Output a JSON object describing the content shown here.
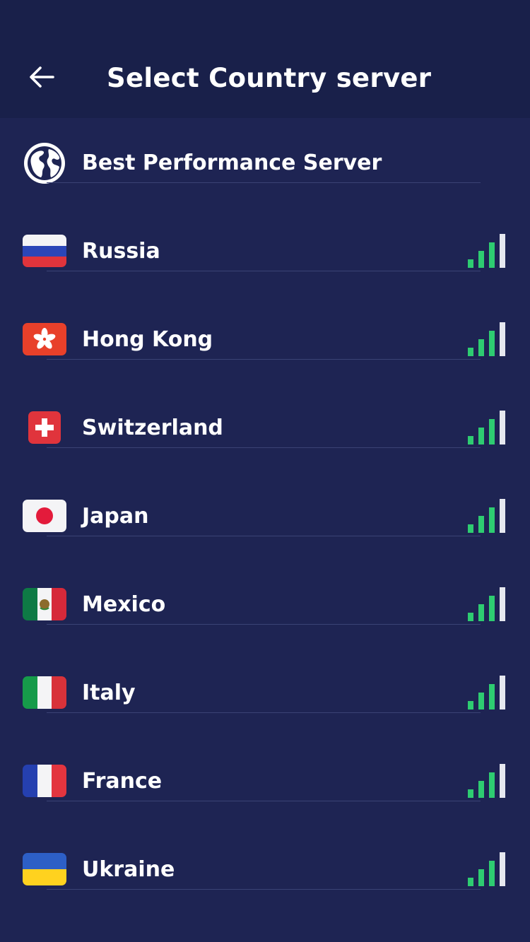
{
  "header": {
    "title": "Select Country server",
    "back_icon": "arrow-left-icon"
  },
  "best_server": {
    "label": "Best Performance Server",
    "icon": "globe-icon"
  },
  "countries": [
    {
      "name": "Russia",
      "flag": "flag-russia-icon"
    },
    {
      "name": "Hong Kong",
      "flag": "flag-hong-kong-icon"
    },
    {
      "name": "Switzerland",
      "flag": "flag-switzerland-icon"
    },
    {
      "name": "Japan",
      "flag": "flag-japan-icon"
    },
    {
      "name": "Mexico",
      "flag": "flag-mexico-icon"
    },
    {
      "name": "Italy",
      "flag": "flag-italy-icon"
    },
    {
      "name": "France",
      "flag": "flag-france-icon"
    },
    {
      "name": "Ukraine",
      "flag": "flag-ukraine-icon"
    }
  ],
  "signal": {
    "active_bars": 3,
    "total_bars": 4,
    "active_color": "#2ecc71",
    "inactive_color": "#e6e8ef"
  },
  "colors": {
    "background": "#1e2453",
    "header_background": "#19204a",
    "divider": "#3b4375",
    "text": "#ffffff"
  }
}
